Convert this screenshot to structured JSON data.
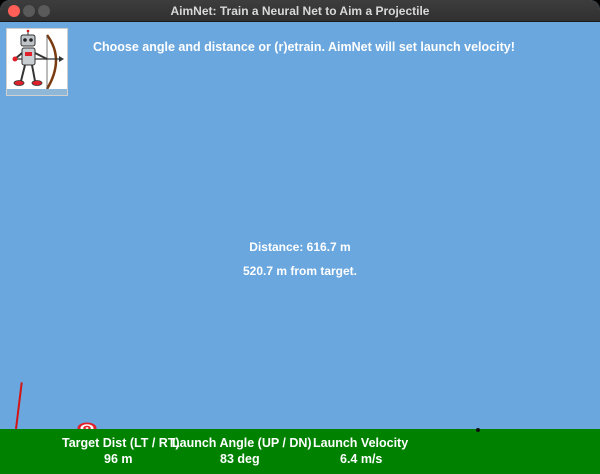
{
  "window": {
    "title": "AimNet: Train a Neural Net to Aim a Projectile"
  },
  "header": {
    "instructions": "Choose angle and distance or (r)etrain. AimNet will set launch velocity!",
    "logo_icon": "robot-archer-icon"
  },
  "readouts": {
    "distance": "Distance: 616.7 m",
    "from_target": "520.7 m from target."
  },
  "stats": {
    "target_label": "Target Dist (LT / RT)",
    "target_value": "96 m",
    "angle_label": "Launch Angle (UP / DN)",
    "angle_value": "83 deg",
    "velocity_label": "Launch Velocity",
    "velocity_value": "6.4 m/s"
  },
  "colors": {
    "sky": "#6aa7de",
    "ground": "#008200",
    "launcher": "#d21414",
    "target_red": "#e0202a",
    "text": "#ffffff"
  }
}
